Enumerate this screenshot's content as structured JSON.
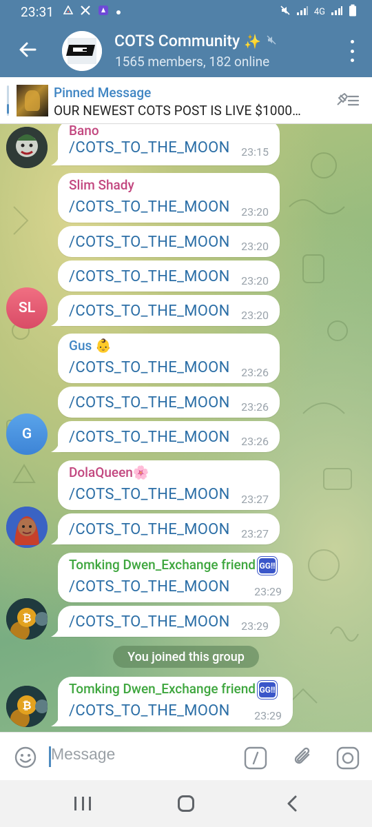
{
  "status_bar": {
    "time": "23:31",
    "left_icons": [
      "triangle-alert-icon",
      "x-logo-icon",
      "proton-icon",
      "dot-icon"
    ],
    "right_icons": [
      "mute-icon",
      "signal-icon",
      "4g-icon",
      "signal-icon",
      "battery-icon"
    ],
    "network_label": "4G"
  },
  "header": {
    "back_icon": "arrow-left-icon",
    "title": "COTS Community",
    "title_emoji": "✨",
    "subtitle": "1565 members, 182 online",
    "menu_icon": "more-vertical-icon",
    "color": "#5181a8"
  },
  "pinned": {
    "label": "Pinned Message",
    "text": "OUR NEWEST COTS POST IS LIVE   $1000…"
  },
  "messages": [
    {
      "sender": "Bano",
      "sender_color": "#c2477f",
      "text": "/COTS_TO_THE_MOON",
      "time": "23:15"
    },
    {
      "sender": "Slim Shady",
      "sender_color": "#c2477f",
      "text": "/COTS_TO_THE_MOON",
      "time": "23:20"
    },
    {
      "text": "/COTS_TO_THE_MOON",
      "time": "23:20"
    },
    {
      "text": "/COTS_TO_THE_MOON",
      "time": "23:20"
    },
    {
      "text": "/COTS_TO_THE_MOON",
      "time": "23:20",
      "avatar_initials": "SL"
    },
    {
      "sender": "Gus",
      "sender_color": "#3f85c3",
      "text": "/COTS_TO_THE_MOON",
      "time": "23:26"
    },
    {
      "text": "/COTS_TO_THE_MOON",
      "time": "23:26"
    },
    {
      "text": "/COTS_TO_THE_MOON",
      "time": "23:26",
      "avatar_initials": "G"
    },
    {
      "sender": "DolaQueen🌸",
      "sender_color": "#c2477f",
      "text": "/COTS_TO_THE_MOON",
      "time": "23:27"
    },
    {
      "text": "/COTS_TO_THE_MOON",
      "time": "23:27"
    },
    {
      "sender": "Tomking Dwen_Exchange friend",
      "sender_color": "#3ea63e",
      "badge": "GG!!",
      "text": "/COTS_TO_THE_MOON",
      "time": "23:29"
    },
    {
      "text": "/COTS_TO_THE_MOON",
      "time": "23:29"
    },
    {
      "sender": "Tomking Dwen_Exchange friend",
      "sender_color": "#3ea63e",
      "badge": "GG!!",
      "text": "/COTS_TO_THE_MOON",
      "time": "23:29"
    }
  ],
  "system_message": "You joined this group",
  "input": {
    "placeholder": "Message",
    "emoji_icon": "smiley-icon",
    "command_icon": "slash-command-icon",
    "attach_icon": "paperclip-icon",
    "camera_icon": "instagram-camera-icon"
  },
  "nav": {
    "recent_icon": "recent-apps-icon",
    "home_icon": "home-icon",
    "back_icon": "back-chevron-icon"
  }
}
